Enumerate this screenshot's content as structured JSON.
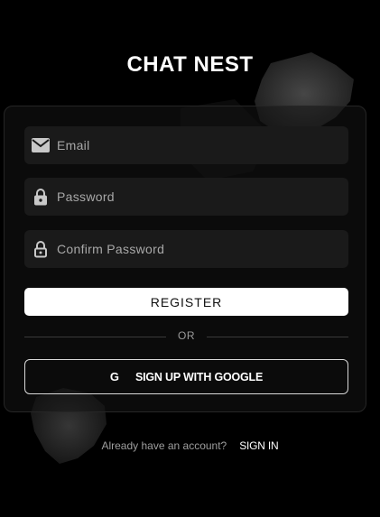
{
  "app": {
    "title": "CHAT NEST"
  },
  "form": {
    "email": {
      "placeholder": "Email",
      "icon": "mail-icon"
    },
    "password": {
      "placeholder": "Password",
      "icon": "lock-icon"
    },
    "confirm_password": {
      "placeholder": "Confirm Password",
      "icon": "lock-outline-icon"
    },
    "register_label": "REGISTER",
    "divider_label": "OR",
    "google": {
      "glyph": "G",
      "label": "SIGN UP WITH GOOGLE"
    }
  },
  "footer": {
    "prompt": "Already have an account?",
    "link_label": "SIGN IN"
  },
  "colors": {
    "background": "#000000",
    "field_bg": "#1a1a1a",
    "primary_button": "#ffffff",
    "text_primary": "#ffffff",
    "text_muted": "#a8a8a8"
  }
}
